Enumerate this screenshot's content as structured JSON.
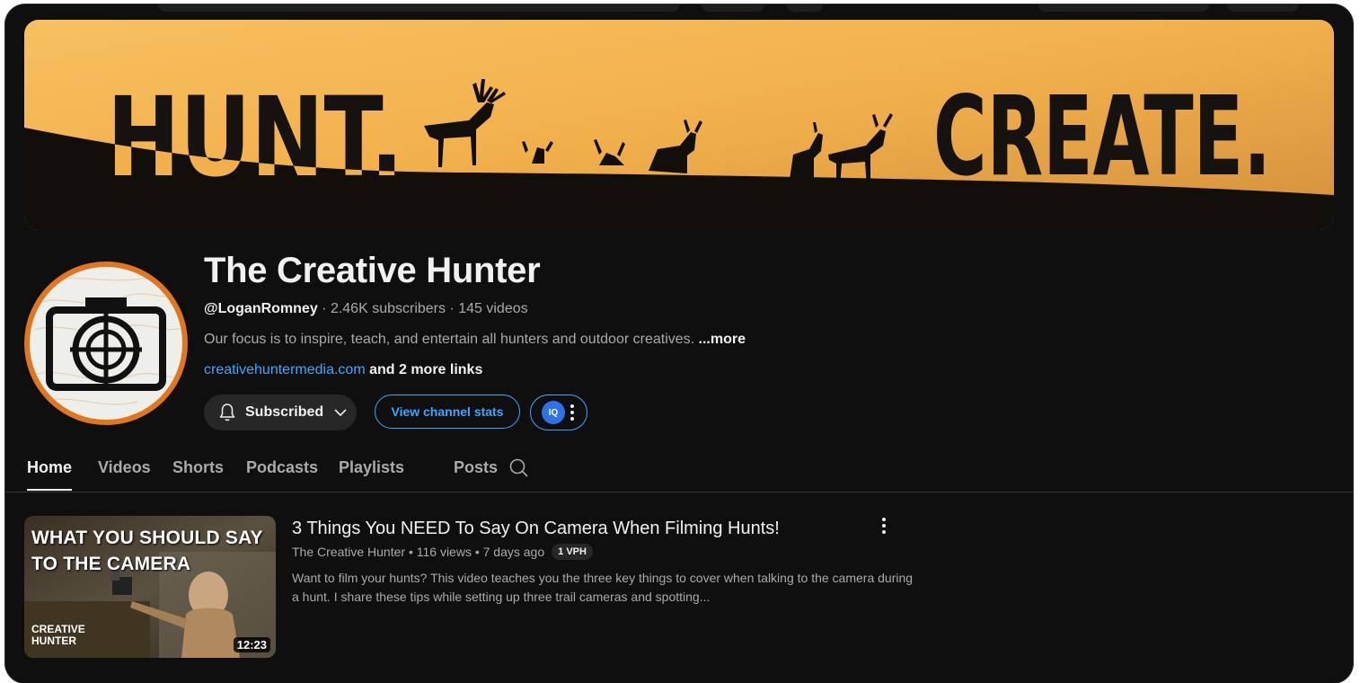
{
  "banner": {
    "left_text": "HUNT.",
    "right_text": "CREATE."
  },
  "channel": {
    "name": "The Creative Hunter",
    "handle": "@LoganRomney",
    "stats": " · 2.46K subscribers · 145 videos",
    "description": "Our focus is to inspire, teach, and entertain all hunters and outdoor creatives. ",
    "more_label": "...more",
    "link": "creativehuntermedia.com",
    "more_links": " and 2 more links"
  },
  "buttons": {
    "subscribed": "Subscribed",
    "view_stats": "View channel stats",
    "iq_logo": "IQ"
  },
  "tabs": [
    "Home",
    "Videos",
    "Shorts",
    "Podcasts",
    "Playlists",
    "Posts"
  ],
  "video": {
    "thumbnail_title": "WHAT YOU SHOULD SAY TO THE CAMERA",
    "thumbnail_logo": "CREATIVE HUNTER",
    "duration": "12:23",
    "title": "3 Things You NEED To Say On Camera When Filming Hunts!",
    "meta": "The Creative Hunter • 116 views • 7 days ago",
    "badge": "1 VPH",
    "description": "Want to film your hunts? This video teaches you the three key things to cover when talking to the camera during a hunt. I share these tips while setting up three trail cameras and spotting..."
  },
  "colors": {
    "background": "#0f0f0f",
    "link": "#3ea6ff",
    "avatar_ring": "#e0771f",
    "banner_sky": "#f2b14e"
  }
}
